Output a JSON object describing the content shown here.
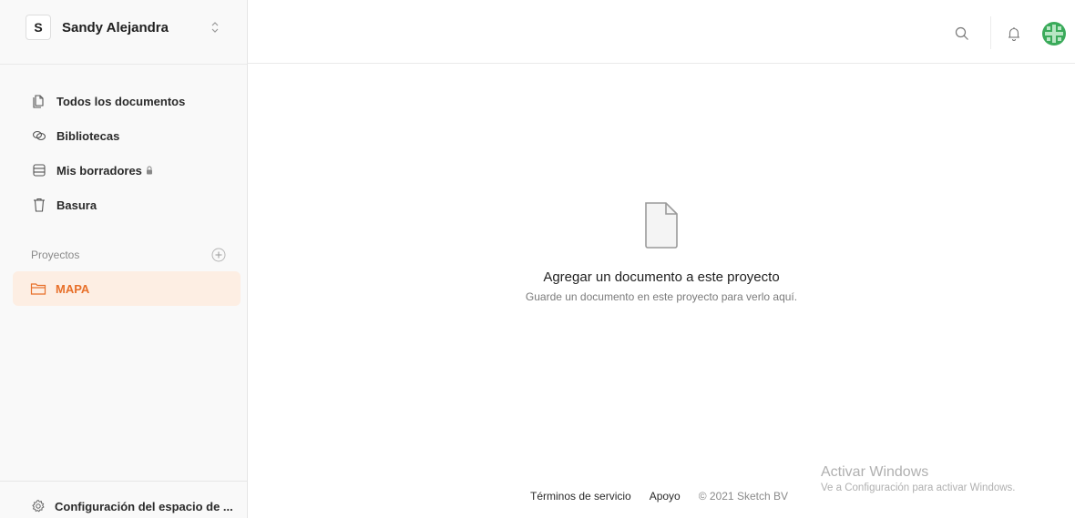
{
  "workspace": {
    "initial": "S",
    "name": "Sandy Alejandra"
  },
  "sidebar": {
    "items": [
      {
        "label": "Todos los documentos",
        "icon": "documents-icon"
      },
      {
        "label": "Bibliotecas",
        "icon": "libraries-icon"
      },
      {
        "label": "Mis borradores",
        "icon": "drafts-icon",
        "locked": true
      },
      {
        "label": "Basura",
        "icon": "trash-icon"
      }
    ],
    "projects_label": "Proyectos",
    "projects": [
      {
        "label": "MAPA",
        "icon": "folder-icon",
        "active": true
      }
    ],
    "settings_label": "Configuración del espacio de ..."
  },
  "empty_state": {
    "title": "Agregar un documento a este proyecto",
    "subtitle": "Guarde un documento en este proyecto para verlo aquí."
  },
  "footer": {
    "terms": "Términos de servicio",
    "support": "Apoyo",
    "copyright": "© 2021 Sketch BV"
  },
  "watermark": {
    "title": "Activar Windows",
    "subtitle": "Ve a Configuración para activar Windows."
  },
  "colors": {
    "accent": "#e8702a",
    "active_bg": "#fdeee3",
    "sidebar_bg": "#f9f9f9",
    "avatar_green": "#3aaa5a"
  }
}
